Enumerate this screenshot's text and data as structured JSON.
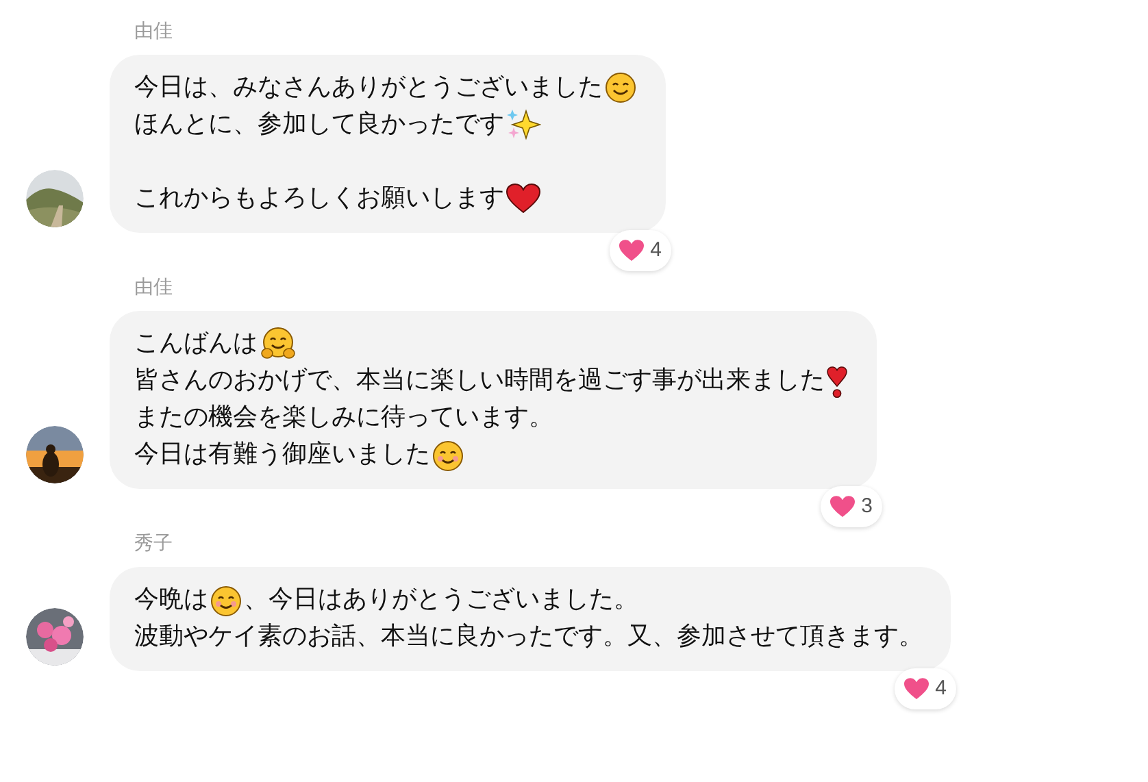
{
  "messages": [
    {
      "sender": "由佳",
      "avatar": {
        "kind": "mountain"
      },
      "paragraphs": [
        [
          [
            {
              "kind": "text",
              "text": "今日は、みなさんありがとうございました"
            },
            {
              "kind": "smile"
            }
          ],
          [
            {
              "kind": "text",
              "text": "ほんとに、参加して良かったです"
            },
            {
              "kind": "sparkles"
            }
          ]
        ],
        [
          [
            {
              "kind": "text",
              "text": "これからもよろしくお願いします"
            },
            {
              "kind": "heart"
            }
          ]
        ]
      ],
      "reaction": {
        "count": "4"
      }
    },
    {
      "sender": "由佳",
      "avatar": {
        "kind": "sunset"
      },
      "paragraphs": [
        [
          [
            {
              "kind": "text",
              "text": "こんばんは"
            },
            {
              "kind": "hug"
            }
          ],
          [
            {
              "kind": "text",
              "text": "皆さんのおかげで、本当に楽しい時間を過ごす事が出来ました"
            },
            {
              "kind": "exclamation"
            }
          ],
          [
            {
              "kind": "text",
              "text": "またの機会を楽しみに待っています。"
            }
          ],
          [
            {
              "kind": "text",
              "text": "今日は有難う御座いました"
            },
            {
              "kind": "blush"
            }
          ]
        ]
      ],
      "reaction": {
        "count": "3"
      }
    },
    {
      "sender": "秀子",
      "avatar": {
        "kind": "flowers"
      },
      "paragraphs": [
        [
          [
            {
              "kind": "text",
              "text": "今晩は"
            },
            {
              "kind": "blush"
            },
            {
              "kind": "text",
              "text": "、今日はありがとうございました。"
            }
          ],
          [
            {
              "kind": "text",
              "text": "波動やケイ素のお話、本当に良かったです。又、参加させて頂きます。"
            }
          ]
        ]
      ],
      "reaction": {
        "count": "4"
      }
    }
  ]
}
